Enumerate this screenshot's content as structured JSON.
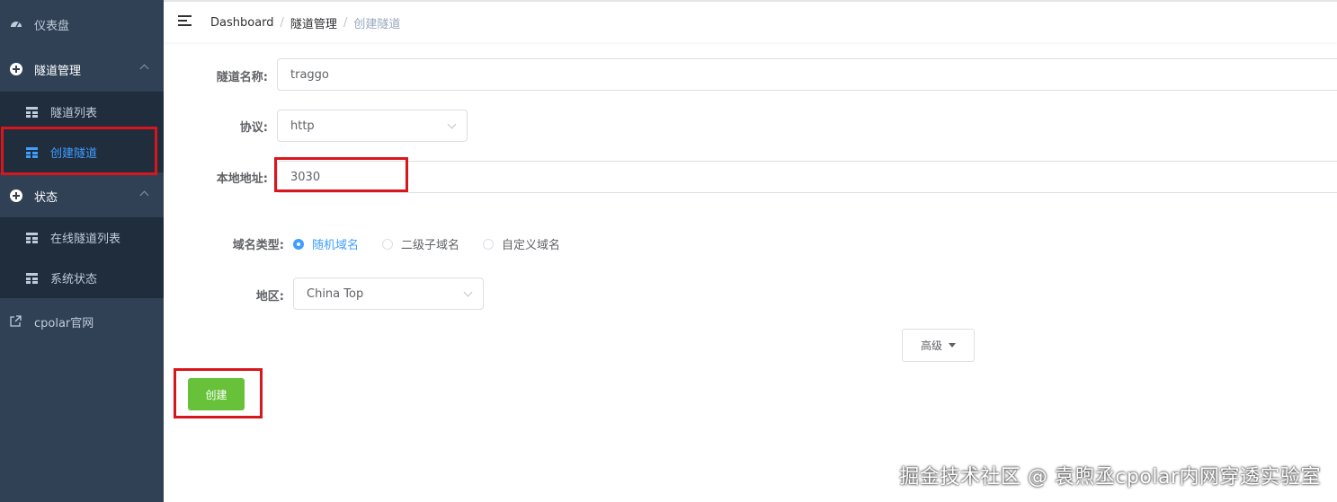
{
  "sidebar": {
    "dashboard_label": "仪表盘",
    "tunnel_mgmt_label": "隧道管理",
    "tunnel_list_label": "隧道列表",
    "create_tunnel_label": "创建隧道",
    "status_label": "状态",
    "online_tunnels_label": "在线隧道列表",
    "system_status_label": "系统状态",
    "cpolar_site_label": "cpolar官网"
  },
  "breadcrumb": {
    "home": "Dashboard",
    "section": "隧道管理",
    "current": "创建隧道",
    "separator": "/"
  },
  "form": {
    "name_label": "隧道名称:",
    "name_value": "traggo",
    "protocol_label": "协议:",
    "protocol_value": "http",
    "local_addr_label": "本地地址:",
    "local_addr_value": "3030",
    "domain_type_label": "域名类型:",
    "domain_options": [
      "随机域名",
      "二级子域名",
      "自定义域名"
    ],
    "domain_selected": "随机域名",
    "region_label": "地区:",
    "region_value": "China Top",
    "advanced_label": "高级",
    "create_label": "创建"
  },
  "watermark": "掘金技术社区 @ 袁煦丞cpolar内网穿透实验室",
  "colors": {
    "sidebar_bg": "#304156",
    "submenu_bg": "#1f2d3d",
    "active": "#409eff",
    "create_button": "#67c23a",
    "highlight_box": "#d9161b"
  }
}
